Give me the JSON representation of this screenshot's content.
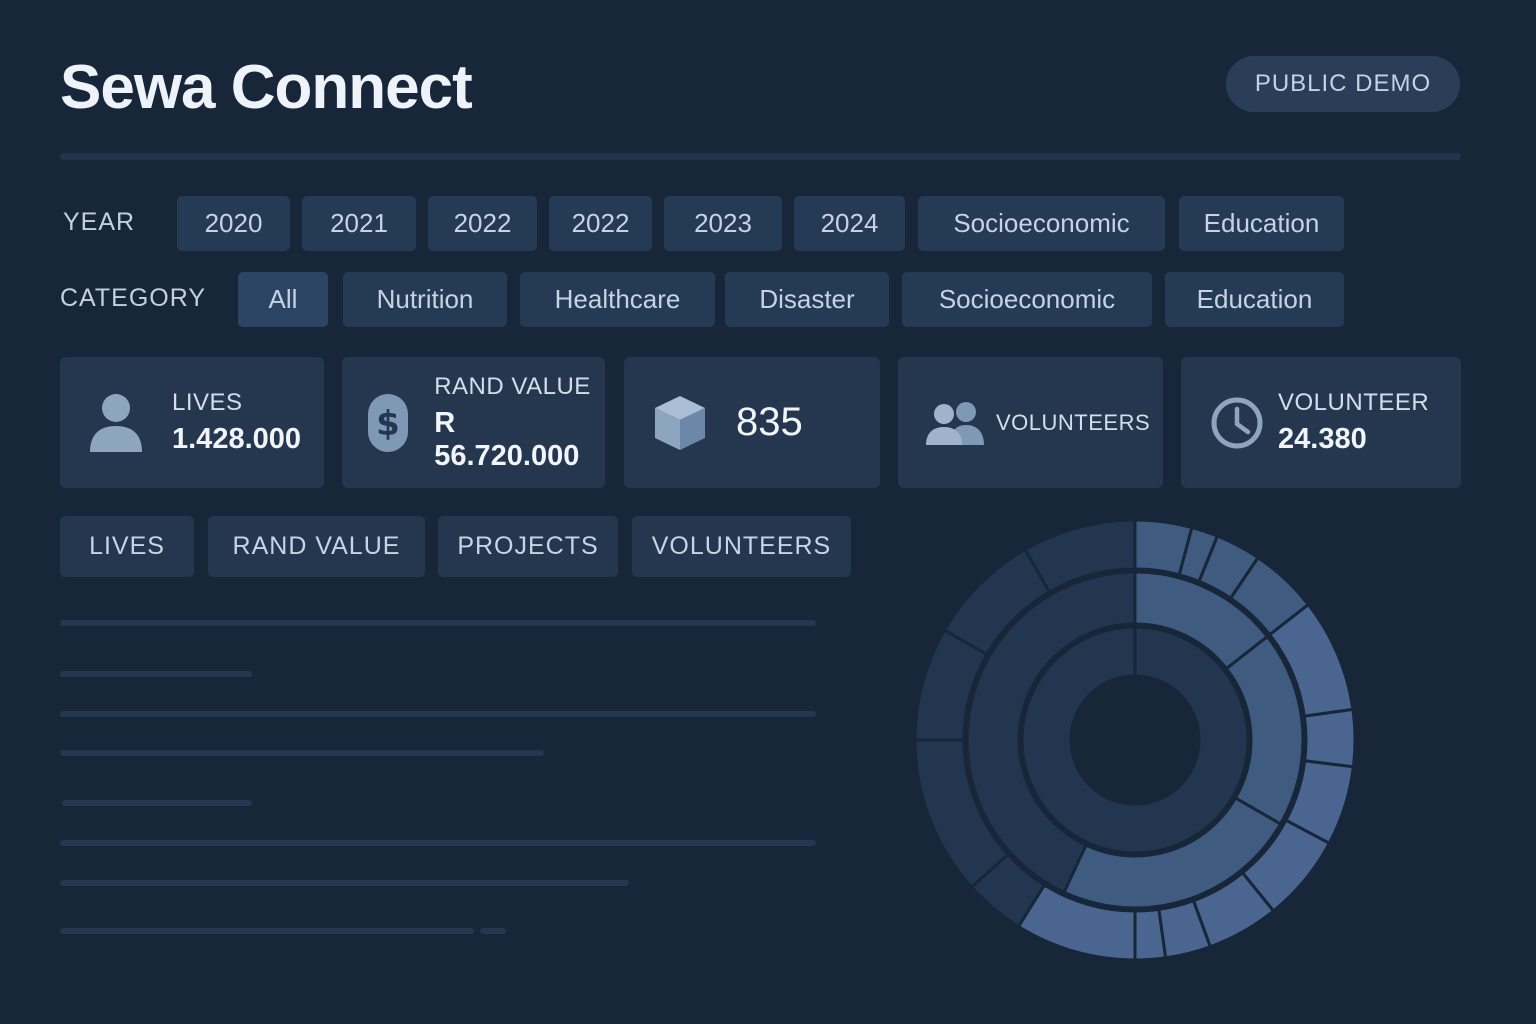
{
  "app": {
    "title": "Sewa Connect",
    "badge": "PUBLIC DEMO"
  },
  "filters": {
    "year_label": "YEAR",
    "year_chips": [
      "2020",
      "2021",
      "2022",
      "2022",
      "2023",
      "2024",
      "Socioeconomic",
      "Education"
    ],
    "category_label": "CATEGORY",
    "category_chips": [
      "All",
      "Nutrition",
      "Healthcare",
      "Disaster",
      "Socioeconomic",
      "Education"
    ]
  },
  "stats": {
    "lives": {
      "label": "LIVES",
      "value": "1.428.000",
      "icon": "person-icon"
    },
    "rand": {
      "label": "RAND VALUE",
      "value": "R 56.720.000",
      "icon": "dollar-icon"
    },
    "projects": {
      "value": "835",
      "icon": "box-icon"
    },
    "volunteers": {
      "label": "VOLUNTEERS",
      "icon": "people-icon"
    },
    "volunteer_hours": {
      "label": "VOLUNTEER",
      "value": "24.380",
      "icon": "clock-icon"
    }
  },
  "tabs": [
    "LIVES",
    "RAND VALUE",
    "PROJECTS",
    "VOLUNTEERS"
  ],
  "colors": {
    "background": "#182639",
    "chip": "#253a55",
    "card": "#24374f",
    "sunburst_dark": "#223650",
    "sunburst_mid": "#3f5b80",
    "sunburst_light": "#4a6690"
  }
}
